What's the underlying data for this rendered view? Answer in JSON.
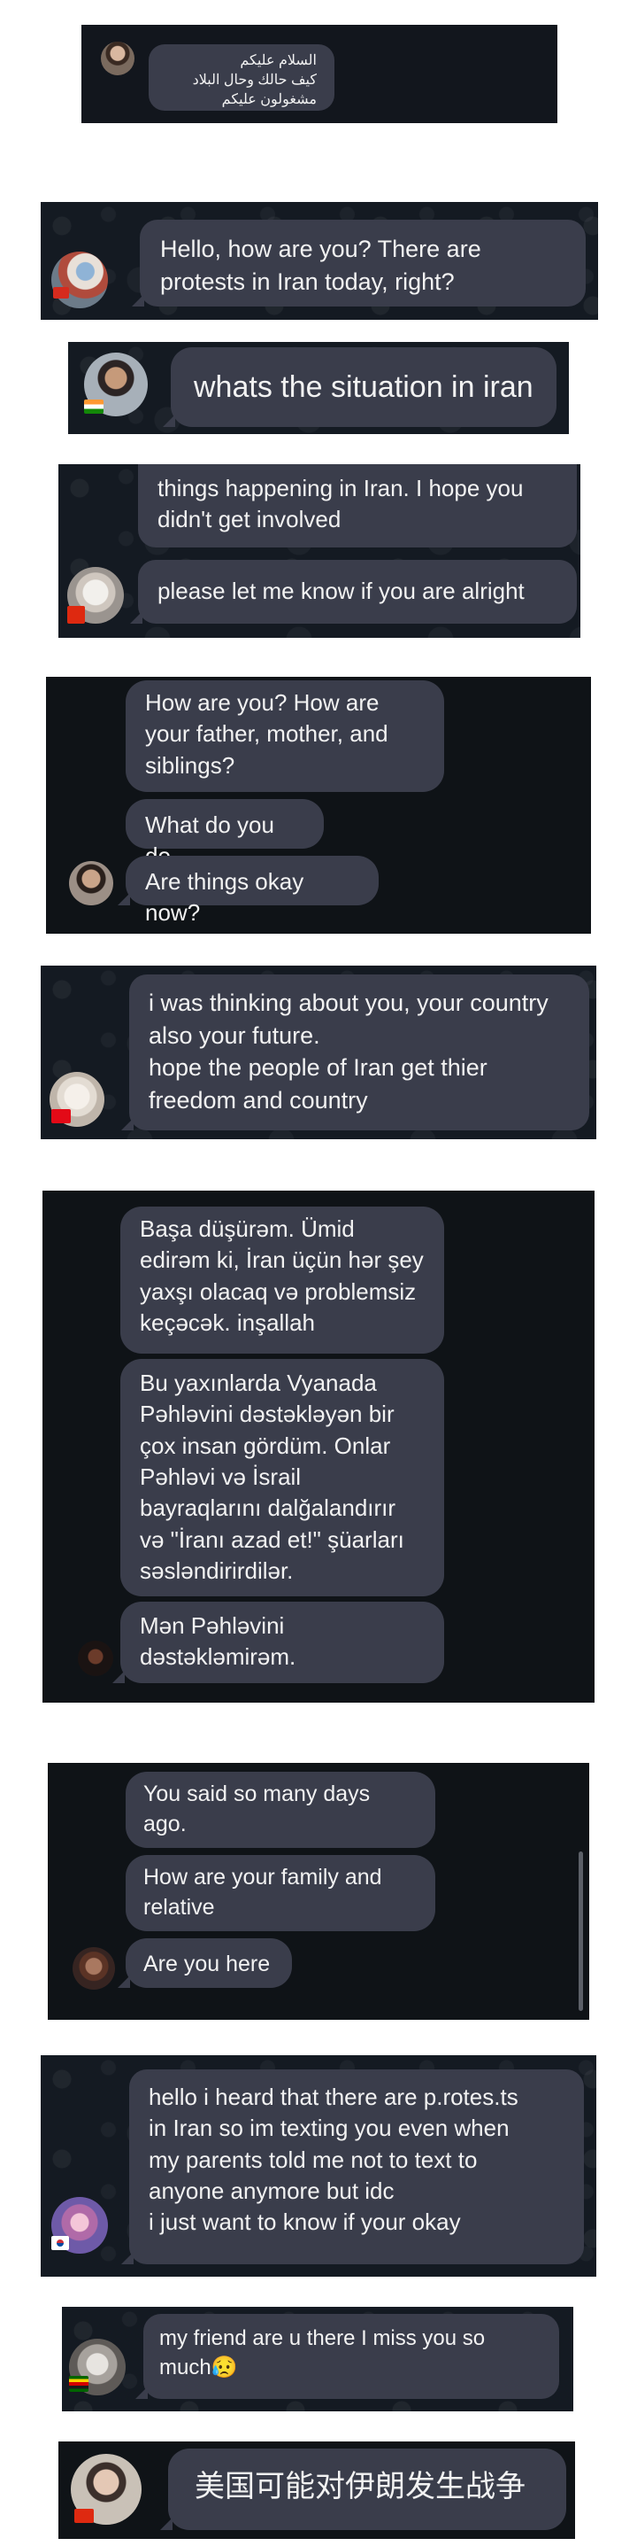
{
  "colors": {
    "panel_bg": "#12161d",
    "bubble_bg": "#3a3d4b",
    "bubble_text": "#f2f2f2",
    "page_bg": "#ffffff"
  },
  "chats": [
    {
      "avatar_icon": "person-photo-icon",
      "messages": [
        "السلام عليكم\nكيف حالك وحال البلاد\nمشغولون عليكم"
      ]
    },
    {
      "avatar_icon": "person-photo-icon",
      "flag": "red-flag-icon",
      "messages": [
        "Hello, how are you? There are\nprotests in Iran today, right?"
      ]
    },
    {
      "avatar_icon": "person-photo-icon",
      "flag": "india-flag-icon",
      "messages": [
        "whats the situation in iran"
      ]
    },
    {
      "avatar_icon": "person-photo-icon",
      "flag": "red-flag-icon",
      "messages": [
        "things happening in Iran. I hope you\ndidn't get involved",
        "please let me know if you are alright"
      ]
    },
    {
      "avatar_icon": "person-photo-icon",
      "messages": [
        "How are you? How are\nyour father, mother, and\nsiblings?",
        "What do you do",
        "Are things okay now?"
      ]
    },
    {
      "avatar_icon": "person-photo-icon",
      "flag": "turkey-flag-icon",
      "messages": [
        "i was thinking about you, your country\nalso your future.\nhope the people of Iran get thier\nfreedom and country"
      ]
    },
    {
      "avatar_icon": "person-photo-icon",
      "messages": [
        "Başa düşürəm. Ümid\nedirəm ki, İran üçün hər şey\nyaxşı olacaq və problemsiz\nkeçəcək. inşallah",
        "Bu yaxınlarda Vyanada\nPəhləvini dəstəkləyən bir\nçox insan gördüm. Onlar\nPəhləvi və İsrail\nbayraqlarını dalğalandırır\nvə \"İranı azad et!\" şüarları\nsəsləndirirdilər.",
        "Mən Pəhləvini\ndəstəkləmirəm."
      ]
    },
    {
      "avatar_icon": "person-photo-icon",
      "messages": [
        "You said so many days\nago.",
        "How are your family and\nrelative",
        "Are you here"
      ]
    },
    {
      "avatar_icon": "person-photo-icon",
      "flag": "korea-flag-icon",
      "messages": [
        "hello i heard that there are p.rotes.ts\nin Iran so im texting you even when\nmy parents told me not to text to\nanyone anymore but idc\ni just want to know if your okay"
      ]
    },
    {
      "avatar_icon": "person-photo-icon",
      "flag": "zimbabwe-flag-icon",
      "messages": [
        "my friend are u there I miss you so\nmuch😥"
      ]
    },
    {
      "avatar_icon": "person-photo-icon",
      "flag": "china-flag-icon",
      "messages": [
        "美国可能对伊朗发生战争"
      ]
    }
  ]
}
